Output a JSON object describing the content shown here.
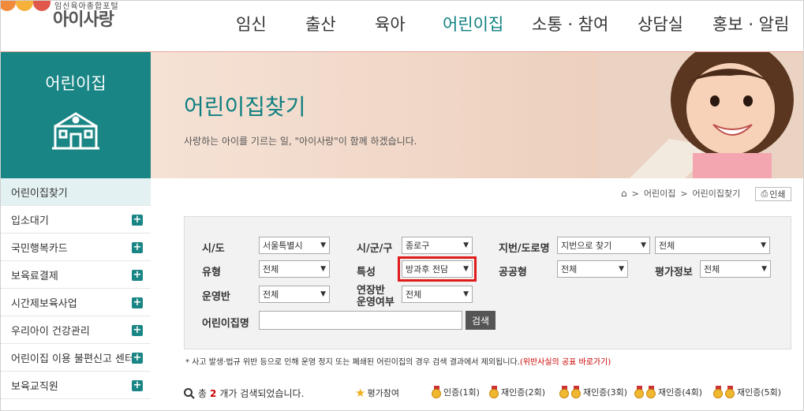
{
  "logo": {
    "tagline": "임신육아종합포털",
    "name": "아이사랑"
  },
  "nav": [
    "임신",
    "출산",
    "육아",
    "어린이집",
    "소통 · 참여",
    "상담실",
    "홍보 · 알림"
  ],
  "sidebar": {
    "title": "어린이집",
    "items": [
      {
        "label": "어린이집찾기"
      },
      {
        "label": "입소대기"
      },
      {
        "label": "국민행복카드"
      },
      {
        "label": "보육료결제"
      },
      {
        "label": "시간제보육사업"
      },
      {
        "label": "우리아이 건강관리"
      },
      {
        "label": "어린이집 이용 불편신고 센터"
      },
      {
        "label": "보육교직원"
      }
    ]
  },
  "banner": {
    "title": "어린이집찾기",
    "subtitle": "사랑하는 아이를 기르는 일, \"아이사랑\"이 함께 하겠습니다."
  },
  "breadcrumb": [
    "어린이집",
    "어린이집찾기"
  ],
  "print_label": "인쇄",
  "search": {
    "sido_label": "시/도",
    "sido_value": "서울특별시",
    "sigungu_label": "시/군/구",
    "sigungu_value": "종로구",
    "addr_label": "지번/도로명",
    "addr_type_value": "지번으로 찾기",
    "addr_value": "전체",
    "type_label": "유형",
    "type_value": "전체",
    "feature_label": "특성",
    "feature_value": "방과후 전담",
    "public_label": "공공형",
    "public_value": "전체",
    "eval_label": "평가정보",
    "eval_value": "전체",
    "class_label": "운영반",
    "class_value": "전체",
    "ext_label_1": "연장반",
    "ext_label_2": "운영여부",
    "ext_value": "전체",
    "name_label": "어린이집명",
    "name_value": "",
    "search_button": "검색"
  },
  "notice": {
    "text": "* 사고 발생·법규 위반 등으로 인해 운영 정지 또는 폐쇄된 어린이집의 경우 검색 결과에서 제외됩니다.",
    "link": "(위반사실의 공표 바로가기)"
  },
  "result": {
    "prefix": "총",
    "count": "2",
    "suffix": "개가 검색되었습니다."
  },
  "legend": [
    "평가참여",
    "인증(1회)",
    "재인증(2회)",
    "재인증(3회)",
    "재인증(4회)",
    "재인증(5회)"
  ],
  "colors": {
    "accent": "#1a8585",
    "highlight": "#e01b1b"
  }
}
